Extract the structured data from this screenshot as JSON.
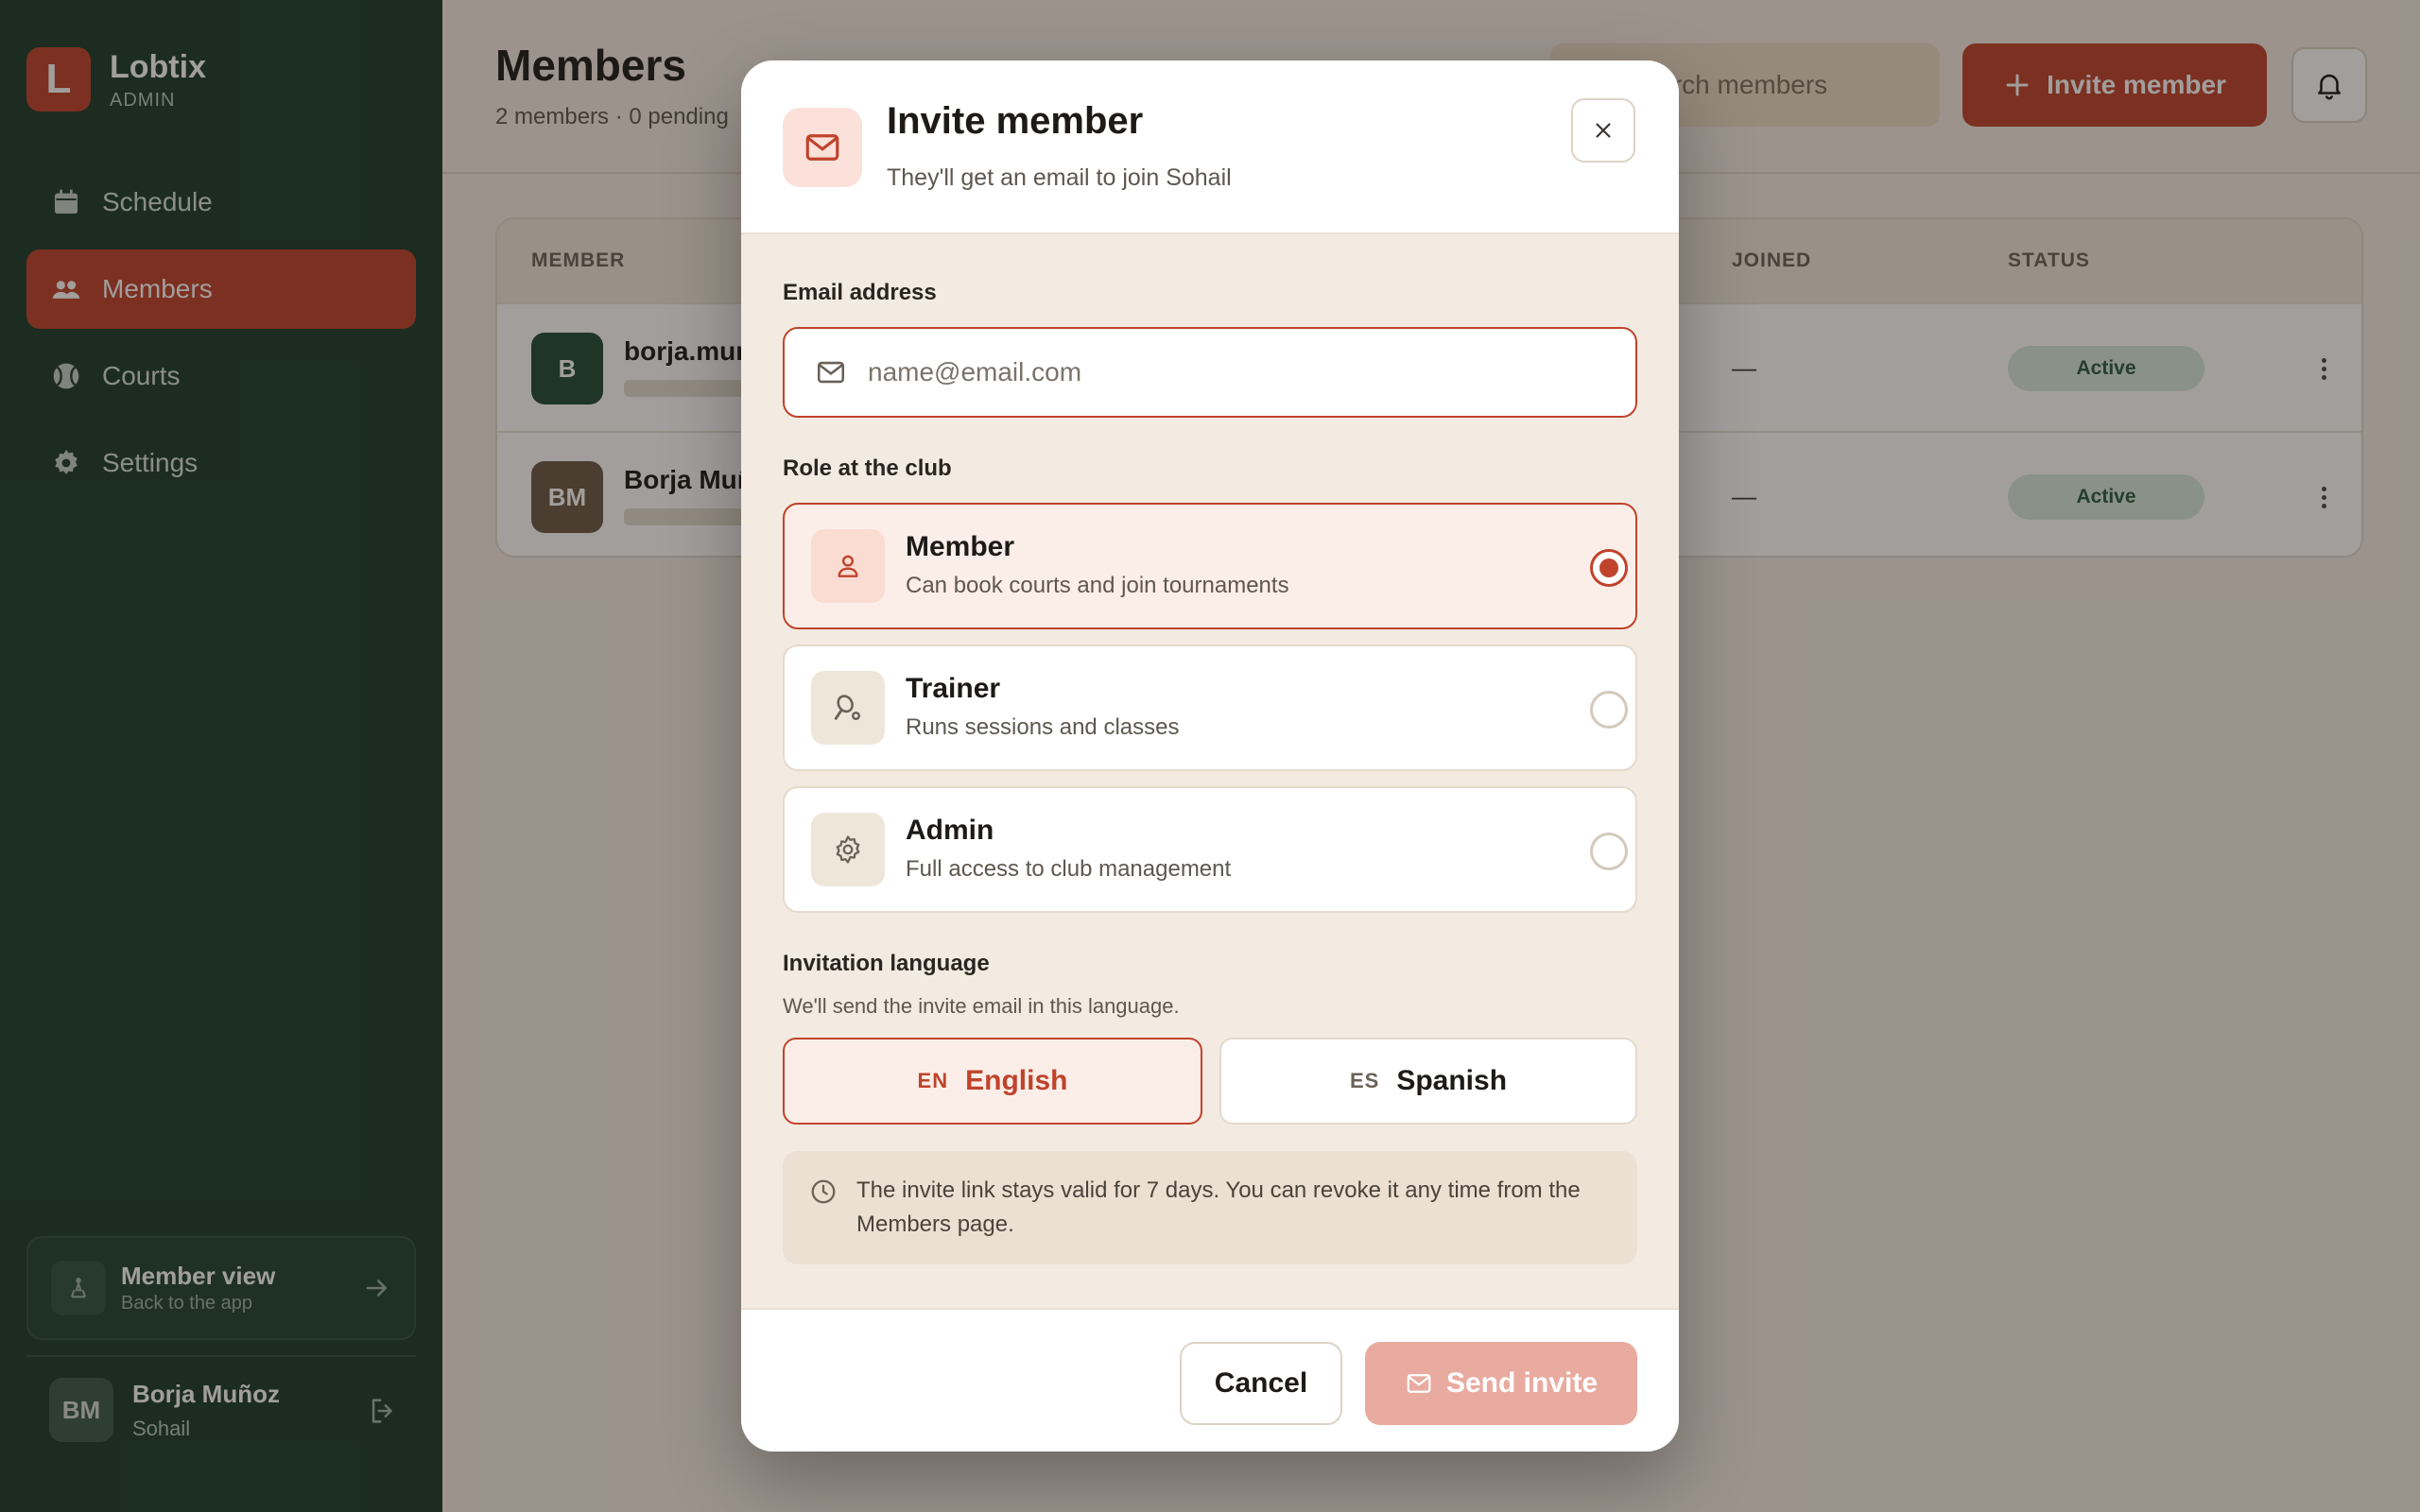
{
  "sidebar": {
    "brand_initial": "L",
    "brand_name": "Lobtix",
    "brand_role": "ADMIN",
    "nav": [
      {
        "label": "Schedule",
        "icon": "calendar-icon"
      },
      {
        "label": "Members",
        "icon": "people-icon",
        "active": true
      },
      {
        "label": "Courts",
        "icon": "ball-icon"
      },
      {
        "label": "Settings",
        "icon": "gear-icon"
      }
    ],
    "member_view": {
      "title": "Member view",
      "subtitle": "Back to the app"
    },
    "user": {
      "initials": "BM",
      "name": "Borja Muñoz",
      "club": "Sohail"
    }
  },
  "main": {
    "title": "Members",
    "subtitle": "2 members · 0 pending",
    "search_placeholder": "Search members",
    "invite_button": "Invite member",
    "table": {
      "headers": {
        "member": "MEMBER",
        "joined": "JOINED",
        "status": "STATUS"
      },
      "rows": [
        {
          "initials": "B",
          "name": "borja.mun",
          "joined": "—",
          "status": "Active",
          "avatar_color": "#1f4a33"
        },
        {
          "initials": "BM",
          "name": "Borja Muñ",
          "joined": "—",
          "status": "Active",
          "avatar_color": "#6b5a45"
        }
      ]
    }
  },
  "modal": {
    "title": "Invite member",
    "subtitle": "They'll get an email to join Sohail",
    "email_label": "Email address",
    "email_placeholder": "name@email.com",
    "email_value": "",
    "role_label": "Role at the club",
    "roles": [
      {
        "title": "Member",
        "desc": "Can book courts and join tournaments",
        "selected": true,
        "icon": "person-icon"
      },
      {
        "title": "Trainer",
        "desc": "Runs sessions and classes",
        "selected": false,
        "icon": "racket-icon"
      },
      {
        "title": "Admin",
        "desc": "Full access to club management",
        "selected": false,
        "icon": "gear-icon"
      }
    ],
    "language_label": "Invitation language",
    "language_help": "We'll send the invite email in this language.",
    "languages": [
      {
        "code": "EN",
        "name": "English",
        "selected": true
      },
      {
        "code": "ES",
        "name": "Spanish",
        "selected": false
      }
    ],
    "note": "The invite link stays valid for 7 days. You can revoke it any time from the Members page.",
    "cancel": "Cancel",
    "send": "Send invite"
  },
  "colors": {
    "accent": "#c0432b",
    "sidebar": "#1b3b2b",
    "modal_bg": "#f3ebe1"
  }
}
